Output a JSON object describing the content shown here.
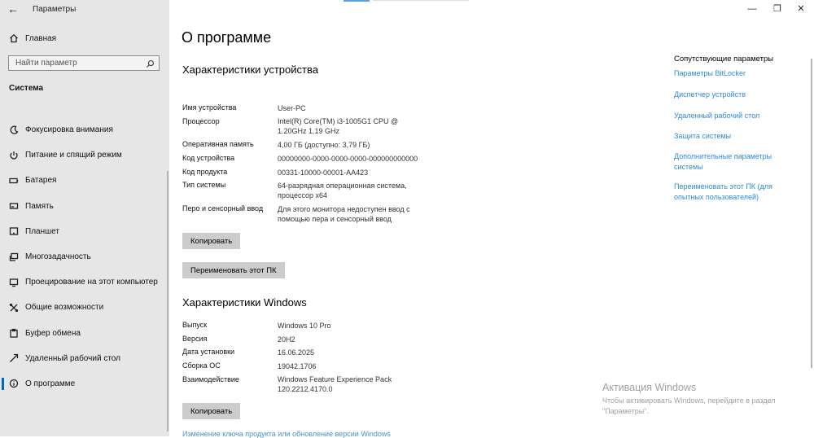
{
  "window": {
    "title": "Параметры"
  },
  "sidebar": {
    "home": "Главная",
    "search_placeholder": "Найти параметр",
    "section": "Система",
    "items": [
      {
        "label": "Фокусировка внимания",
        "icon": "moon-icon"
      },
      {
        "label": "Питание и спящий режим",
        "icon": "power-icon"
      },
      {
        "label": "Батарея",
        "icon": "battery-icon"
      },
      {
        "label": "Память",
        "icon": "storage-icon"
      },
      {
        "label": "Планшет",
        "icon": "tablet-icon"
      },
      {
        "label": "Многозадачность",
        "icon": "multitask-icon"
      },
      {
        "label": "Проецирование на этот компьютер",
        "icon": "project-icon"
      },
      {
        "label": "Общие возможности",
        "icon": "shared-icon"
      },
      {
        "label": "Буфер обмена",
        "icon": "clipboard-icon"
      },
      {
        "label": "Удаленный рабочий стол",
        "icon": "remote-desktop-icon"
      },
      {
        "label": "О программе",
        "icon": "info-icon",
        "active": true
      }
    ]
  },
  "main": {
    "title": "О программе",
    "device": {
      "heading": "Характеристики устройства",
      "rows": [
        {
          "label": "Имя устройства",
          "value": "User-PC"
        },
        {
          "label": "Процессор",
          "value": "Intel(R) Core(TM) i3-1005G1 CPU @ 1.20GHz   1.19 GHz"
        },
        {
          "label": "Оперативная память",
          "value": "4,00 ГБ (доступно: 3,79 ГБ)"
        },
        {
          "label": "Код устройства",
          "value": "00000000-0000-0000-0000-000000000000"
        },
        {
          "label": "Код продукта",
          "value": "00331-10000-00001-AA423"
        },
        {
          "label": "Тип системы",
          "value": "64-разрядная операционная система, процессор x64"
        },
        {
          "label": "Перо и сенсорный ввод",
          "value": "Для этого монитора недоступен ввод с помощью пера и сенсорный ввод"
        }
      ],
      "copy_button": "Копировать",
      "rename_button": "Переименовать этот ПК"
    },
    "windows": {
      "heading": "Характеристики Windows",
      "rows": [
        {
          "label": "Выпуск",
          "value": "Windows 10 Pro"
        },
        {
          "label": "Версия",
          "value": "20H2"
        },
        {
          "label": "Дата установки",
          "value": "16.06.2025"
        },
        {
          "label": "Сборка ОС",
          "value": "19042.1706"
        },
        {
          "label": "Взаимодействие",
          "value": "Windows Feature Experience Pack 120.2212.4170.0"
        }
      ],
      "copy_button": "Копировать",
      "change_key_link": "Изменение ключа продукта или обновление версии Windows"
    }
  },
  "related": {
    "title": "Сопутствующие параметры",
    "links": [
      "Параметры BitLocker",
      "Диспетчер устройств",
      "Удаленный рабочий стол",
      "Защита системы",
      "Дополнительные параметры системы",
      "Переименовать этот ПК (для опытных пользователей)"
    ]
  },
  "activation": {
    "title": "Активация Windows",
    "text": "Чтобы активировать Windows, перейдите в раздел \"Параметры\"."
  },
  "colors": {
    "accent": "#0067c0",
    "link": "#2e8ad8",
    "sidebar_bg": "#e6e6e6"
  }
}
